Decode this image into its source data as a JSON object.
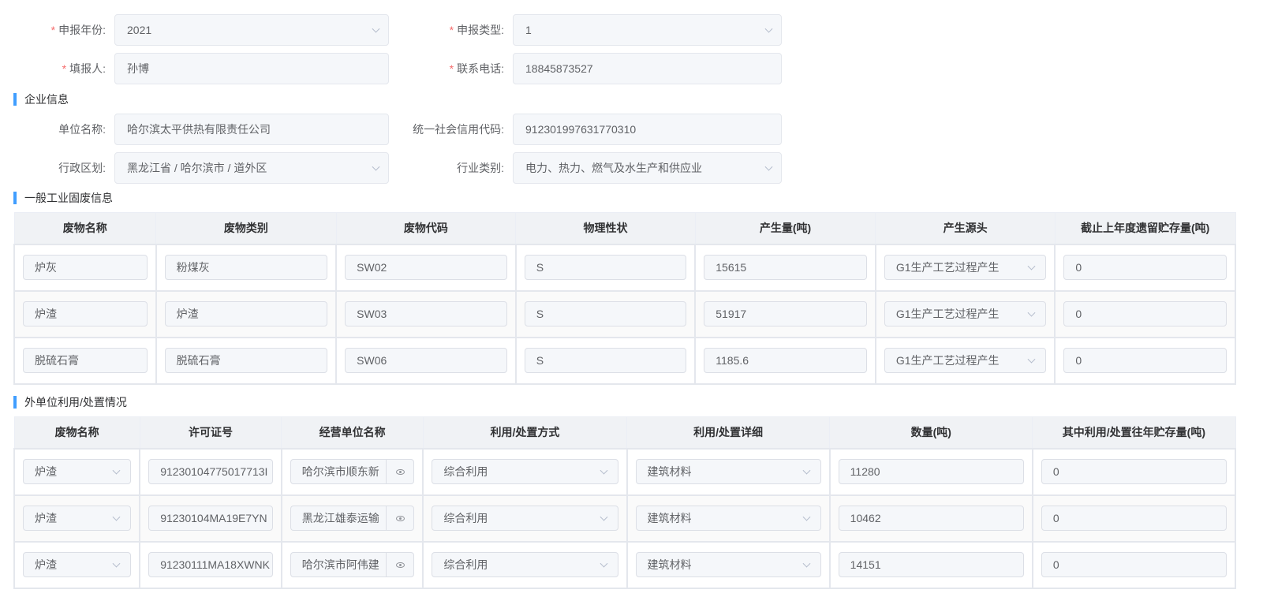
{
  "header_form": {
    "year": {
      "label": "申报年份:",
      "required": true,
      "value": "2021"
    },
    "type": {
      "label": "申报类型:",
      "required": true,
      "value": "1"
    },
    "reporter": {
      "label": "填报人:",
      "required": true,
      "value": "孙博"
    },
    "phone": {
      "label": "联系电话:",
      "required": true,
      "value": "18845873527"
    }
  },
  "enterprise": {
    "title": "企业信息",
    "unit_name": {
      "label": "单位名称:",
      "value": "哈尔滨太平供热有限责任公司"
    },
    "credit_code": {
      "label": "统一社会信用代码:",
      "value": "912301997631770310"
    },
    "region": {
      "label": "行政区划:",
      "value": "黑龙江省 / 哈尔滨市 / 道外区"
    },
    "industry": {
      "label": "行业类别:",
      "value": "电力、热力、燃气及水生产和供应业"
    }
  },
  "solid_waste": {
    "title": "一般工业固废信息",
    "columns": [
      "废物名称",
      "废物类别",
      "废物代码",
      "物理性状",
      "产生量(吨)",
      "产生源头",
      "截止上年度遗留贮存量(吨)"
    ],
    "rows": [
      [
        "炉灰",
        "粉煤灰",
        "SW02",
        "S",
        "15615",
        "G1生产工艺过程产生",
        "0"
      ],
      [
        "炉渣",
        "炉渣",
        "SW03",
        "S",
        "51917",
        "G1生产工艺过程产生",
        "0"
      ],
      [
        "脱硫石膏",
        "脱硫石膏",
        "SW06",
        "S",
        "1185.6",
        "G1生产工艺过程产生",
        "0"
      ]
    ]
  },
  "external_disposal": {
    "title": "外单位利用/处置情况",
    "columns": [
      "废物名称",
      "许可证号",
      "经营单位名称",
      "利用/处置方式",
      "利用/处置详细",
      "数量(吨)",
      "其中利用/处置往年贮存量(吨)"
    ],
    "rows": [
      [
        "炉渣",
        "91230104775017713I",
        "哈尔滨市顺东新",
        "综合利用",
        "建筑材料",
        "11280",
        "0"
      ],
      [
        "炉渣",
        "91230104MA19E7YN",
        "黑龙江雄泰运输",
        "综合利用",
        "建筑材料",
        "10462",
        "0"
      ],
      [
        "炉渣",
        "91230111MA18XWNK",
        "哈尔滨市阿伟建",
        "综合利用",
        "建筑材料",
        "14151",
        "0"
      ]
    ]
  }
}
